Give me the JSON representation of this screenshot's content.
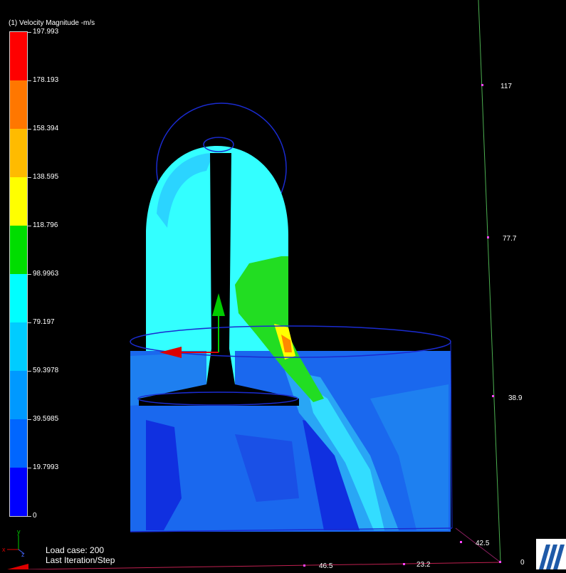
{
  "legend": {
    "title": "(1) Velocity Magnitude -m/s",
    "colors": [
      "#ff0000",
      "#ff7700",
      "#ffbb00",
      "#ffff00",
      "#00dd00",
      "#00ffff",
      "#00ccff",
      "#0099ff",
      "#0066ff",
      "#0000ff"
    ],
    "ticks": [
      "197.993",
      "178.193",
      "158.394",
      "138.595",
      "118.796",
      "98.9963",
      "79.197",
      "59.3978",
      "39.5985",
      "19.7993",
      "0"
    ]
  },
  "axes": {
    "vertical_ticks": [
      "117",
      "77.7",
      "38.9",
      "0"
    ],
    "horizontal_ticks": [
      "42.5",
      "46.5",
      "23.2"
    ],
    "triad_labels": [
      "y",
      "x",
      "z"
    ]
  },
  "status": {
    "load_case": "Load case: 200",
    "iteration": "Last Iteration/Step"
  }
}
